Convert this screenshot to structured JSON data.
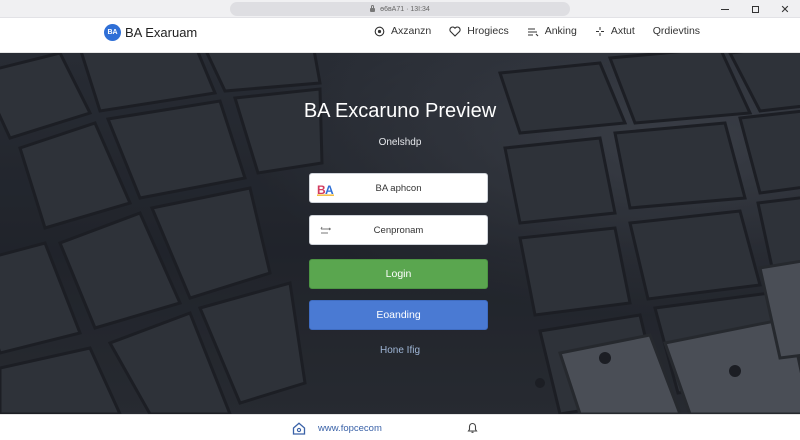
{
  "window": {
    "address": "ө6вА71 · 13Ι:34",
    "controls": [
      "minimize",
      "maximize",
      "close"
    ]
  },
  "navbar": {
    "logo_text": "BA",
    "brand_name": "BA Exaruam",
    "items": [
      {
        "label": "Axzanzn",
        "icon": "target-icon"
      },
      {
        "label": "Hrogiecs",
        "icon": "heart-icon"
      },
      {
        "label": "Anking",
        "icon": "signal-icon"
      },
      {
        "label": "Axtut",
        "icon": "sparkle-icon"
      },
      {
        "label": "Qrdievtins",
        "icon": "none"
      }
    ]
  },
  "hero": {
    "title": "BA Excaruno Preview",
    "subtitle": "Onelshdp",
    "account_field": {
      "text": "BA aphcon",
      "icon": "ba-logo-icon"
    },
    "password_field": {
      "text": "Cenpronam",
      "icon": "key-icon"
    },
    "login_button": "Login",
    "loading_button": "Eoanding",
    "help_link": "Hone Ifig"
  },
  "footer": {
    "url": "www.fopcecom",
    "icons": [
      "home-icon",
      "bell-icon"
    ]
  },
  "colors": {
    "login_green": "#5aa64f",
    "loading_blue": "#4a7ad3",
    "brand_blue": "#2f6fd6",
    "hero_dark": "#262a31"
  }
}
